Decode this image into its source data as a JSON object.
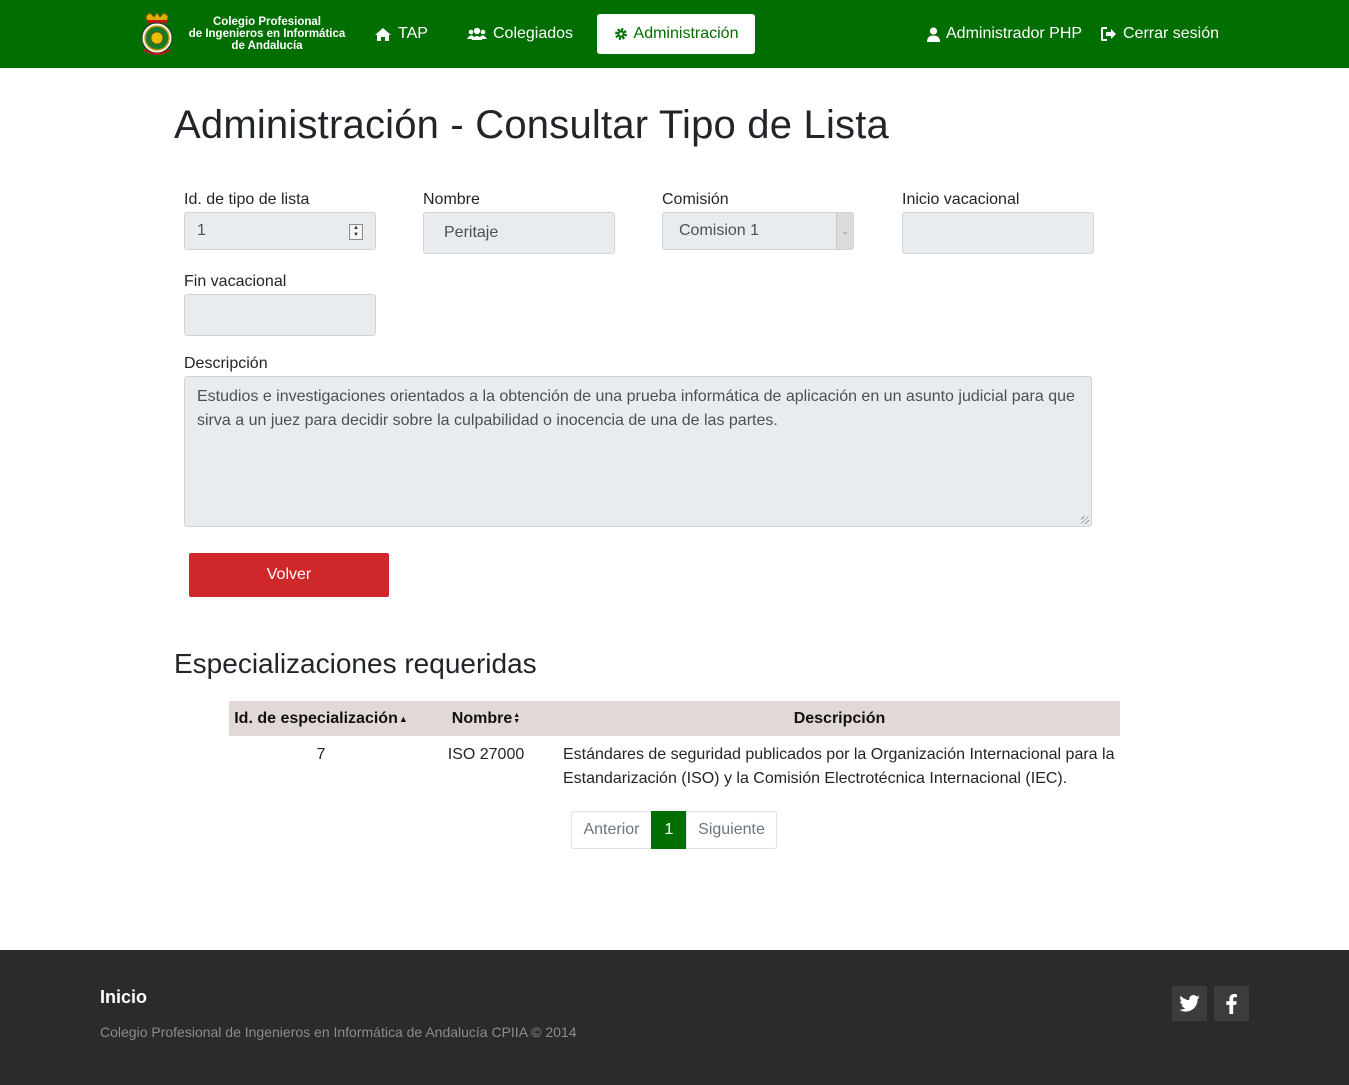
{
  "brand": {
    "line1": "Colegio Profesional",
    "line2": "de Ingenieros en Informática",
    "line3": "de Andalucía"
  },
  "nav": {
    "tap": "TAP",
    "colegiados": "Colegiados",
    "admin": "Administración",
    "user": "Administrador PHP",
    "logout": "Cerrar sesión"
  },
  "page": {
    "title": "Administración - Consultar Tipo de Lista"
  },
  "form": {
    "id_label": "Id. de tipo de lista",
    "id_value": "1",
    "nombre_label": "Nombre",
    "nombre_value": "Peritaje",
    "comision_label": "Comisión",
    "comision_value": "Comision 1",
    "inicio_label": "Inicio vacacional",
    "inicio_value": "",
    "fin_label": "Fin vacacional",
    "fin_value": "",
    "descripcion_label": "Descripción",
    "descripcion_value": "Estudios e investigaciones orientados a la obtención de una prueba informática de aplicación en un asunto judicial para que sirva a un juez para decidir sobre la culpabilidad o inocencia de una de las partes.",
    "volver": "Volver"
  },
  "especializaciones": {
    "title": "Especializaciones requeridas",
    "headers": {
      "id": "Id. de especialización",
      "nombre": "Nombre",
      "descripcion": "Descripción"
    },
    "rows": [
      {
        "id": "7",
        "nombre": "ISO 27000",
        "descripcion": "Estándares de seguridad publicados por la Organización Internacional para la Estandarización (ISO) y la Comisión Electrotécnica Internacional (IEC)."
      }
    ]
  },
  "pagination": {
    "prev": "Anterior",
    "current": "1",
    "next": "Siguiente"
  },
  "footer": {
    "title": "Inicio",
    "copyright": "Colegio Profesional de Ingenieros en Informática de Andalucía CPIIA © 2014"
  },
  "colors": {
    "navbar": "#006e00",
    "danger": "#d0282a",
    "footer": "#292b2c",
    "table_header": "#e2d9d6"
  }
}
